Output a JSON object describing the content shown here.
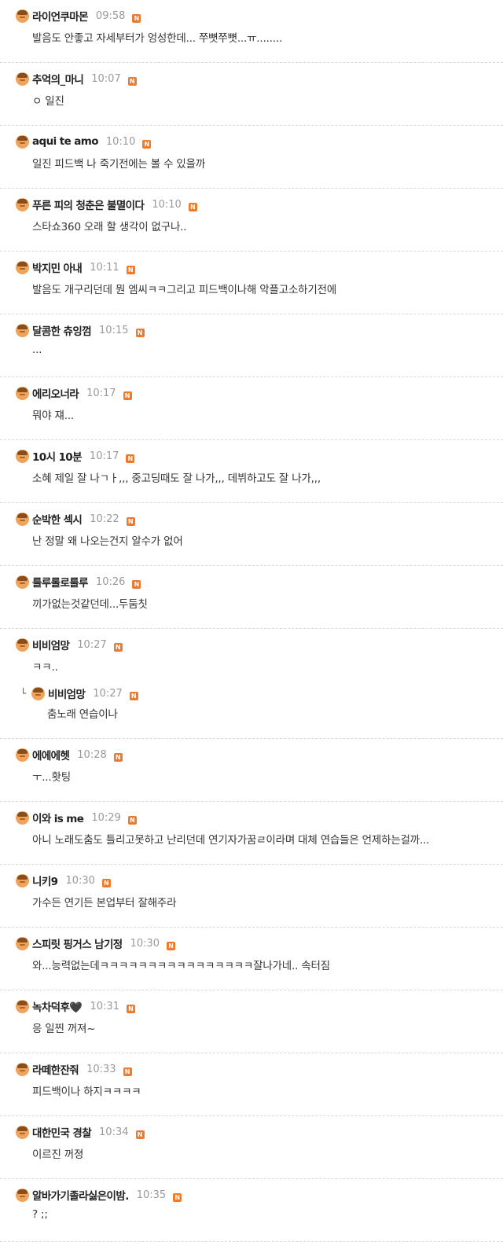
{
  "comments": [
    {
      "author": "라이언쿠마몬",
      "time": "09:58",
      "badge": "N",
      "text": "발음도 안좋고 자세부터가 엉성한데... 쭈뼛쭈뼛...ㅠ........"
    },
    {
      "author": "추억의_마니",
      "time": "10:07",
      "badge": "N",
      "text": "ㅇ 일진"
    },
    {
      "author": "aqui te amo",
      "time": "10:10",
      "badge": "N",
      "text": "일진 피드백 나 죽기전에는 볼 수 있을까"
    },
    {
      "author": "푸른 피의 청춘은 불멸이다",
      "time": "10:10",
      "badge": "N",
      "text": "스타쇼360 오래 할 생각이 없구나.."
    },
    {
      "author": "박지민 아내",
      "time": "10:11",
      "badge": "N",
      "text": "발음도 개구리던데 뭔 엠씨ㅋㅋ그리고 피드백이나해 악플고소하기전에"
    },
    {
      "author": "달콤한 츄잉껌",
      "time": "10:15",
      "badge": "N",
      "text": "..."
    },
    {
      "author": "에리오너라",
      "time": "10:17",
      "badge": "N",
      "text": "뭐야 쟤..."
    },
    {
      "author": "10시 10분",
      "time": "10:17",
      "badge": "N",
      "text": "소혜 제일 잘 나ㄱㅏ,,, 중고딩때도 잘 나가,,, 데뷔하고도 잘 나가,,,"
    },
    {
      "author": "순박한 섹시",
      "time": "10:22",
      "badge": "N",
      "text": "난 정말 왜 나오는건지 알수가 없어"
    },
    {
      "author": "룰루롤로룰루",
      "time": "10:26",
      "badge": "N",
      "text": "끼가없는것같던데...두둠칫"
    },
    {
      "author": "비비엄망",
      "time": "10:27",
      "badge": "N",
      "text": "ㅋㅋ..",
      "reply": {
        "arrow": "└",
        "author": "비비엄망",
        "time": "10:27",
        "badge": "N",
        "text": "춤노래 연습이나"
      }
    },
    {
      "author": "에에에헷",
      "time": "10:28",
      "badge": "N",
      "text": "ㅜ...홧팅"
    },
    {
      "author": "이와 is me",
      "time": "10:29",
      "badge": "N",
      "text": "아니 노래도춤도 틀리고못하고 난리던데 연기자가꿈ㄹ이라며 대체 연습들은 언제하는걸까..."
    },
    {
      "author": "니키9",
      "time": "10:30",
      "badge": "N",
      "text": "가수든 연기든 본업부터 잘해주라"
    },
    {
      "author": "스피릿 핑거스 남기정",
      "time": "10:30",
      "badge": "N",
      "text": "와...능력없는데ㅋㅋㅋㅋㅋㅋㅋㅋㅋㅋㅋㅋㅋㅋㅋㅋ잘나가네.. 속터짐"
    },
    {
      "author": "녹차덕후🖤",
      "time": "10:31",
      "badge": "N",
      "text": "응 일찐 꺼져~"
    },
    {
      "author": "라떼한잔줘",
      "time": "10:33",
      "badge": "N",
      "text": "피드백이나 하지ㅋㅋㅋㅋ"
    },
    {
      "author": "대한민국 경찰",
      "time": "10:34",
      "badge": "N",
      "text": "이르진 꺼졍"
    },
    {
      "author": "알바가기졸라싫은이밤.",
      "time": "10:35",
      "badge": "N",
      "text": "? ;;"
    }
  ]
}
